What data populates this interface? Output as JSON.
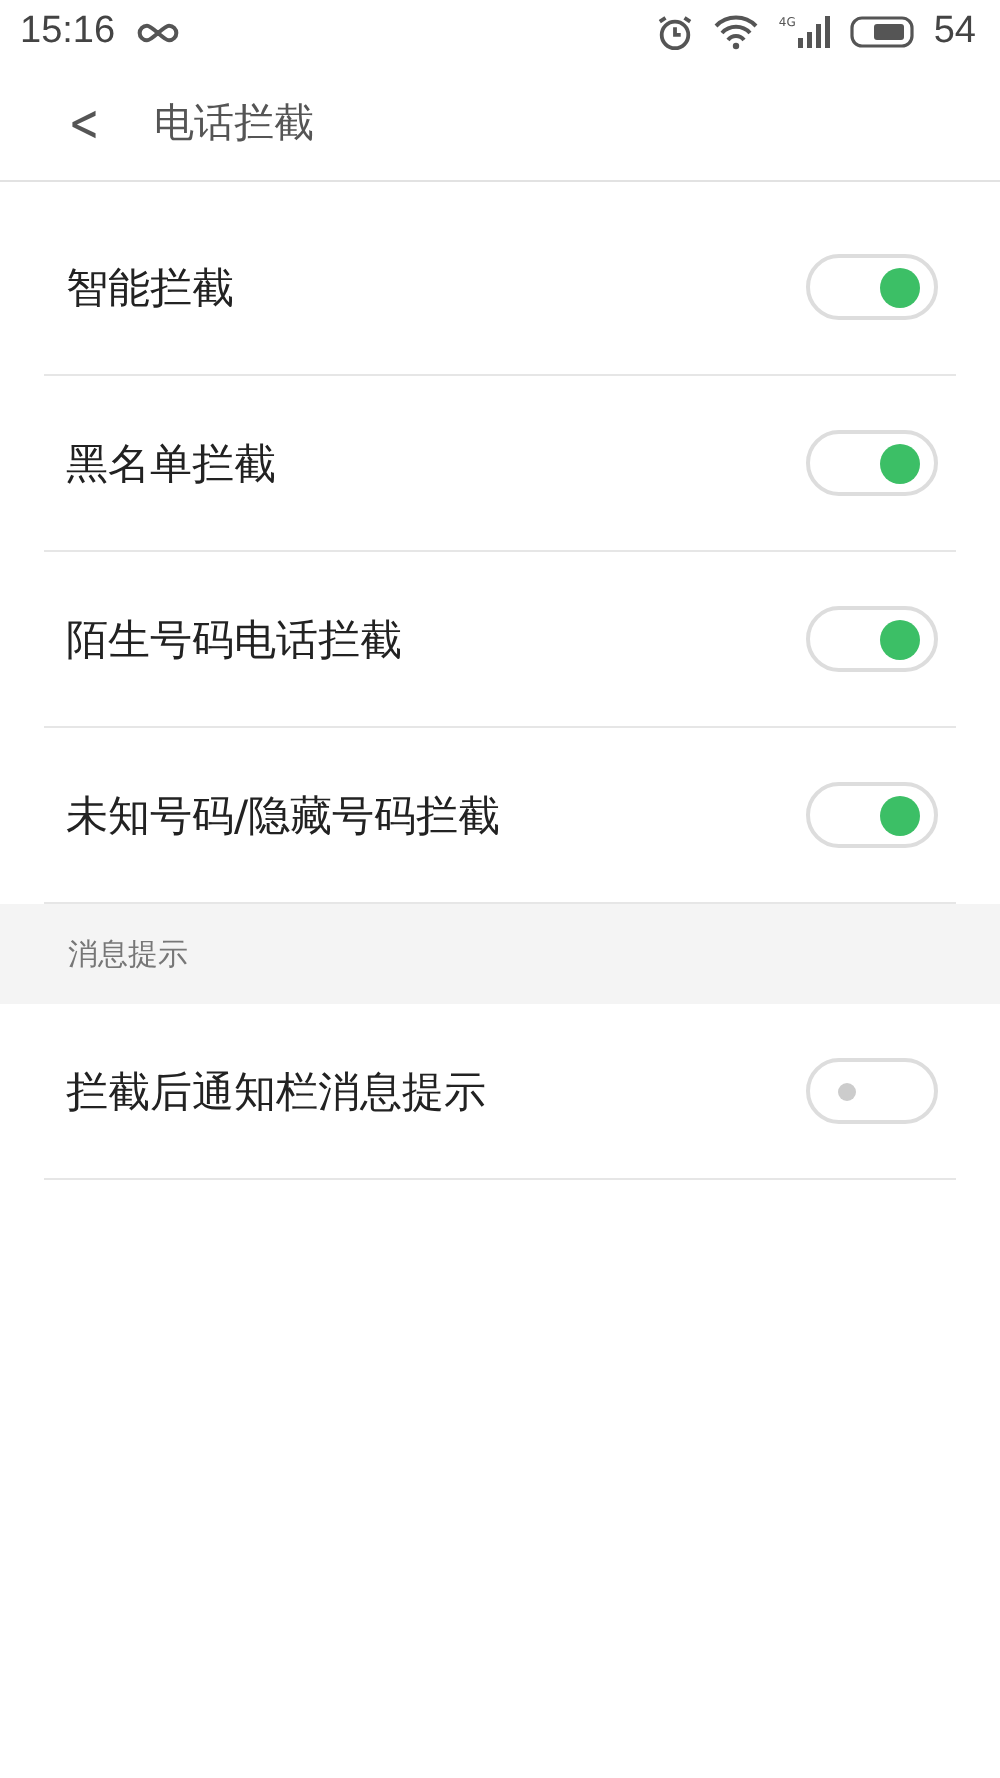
{
  "status_bar": {
    "time": "15:16",
    "network": "4G",
    "battery": "54"
  },
  "header": {
    "back": "<",
    "title": "电话拦截"
  },
  "sections": [
    {
      "items": [
        {
          "label": "智能拦截",
          "on": true
        },
        {
          "label": "黑名单拦截",
          "on": true
        },
        {
          "label": "陌生号码电话拦截",
          "on": true
        },
        {
          "label": "未知号码/隐藏号码拦截",
          "on": true
        }
      ]
    },
    {
      "title": "消息提示",
      "items": [
        {
          "label": "拦截后通知栏消息提示",
          "on": false
        }
      ]
    }
  ]
}
